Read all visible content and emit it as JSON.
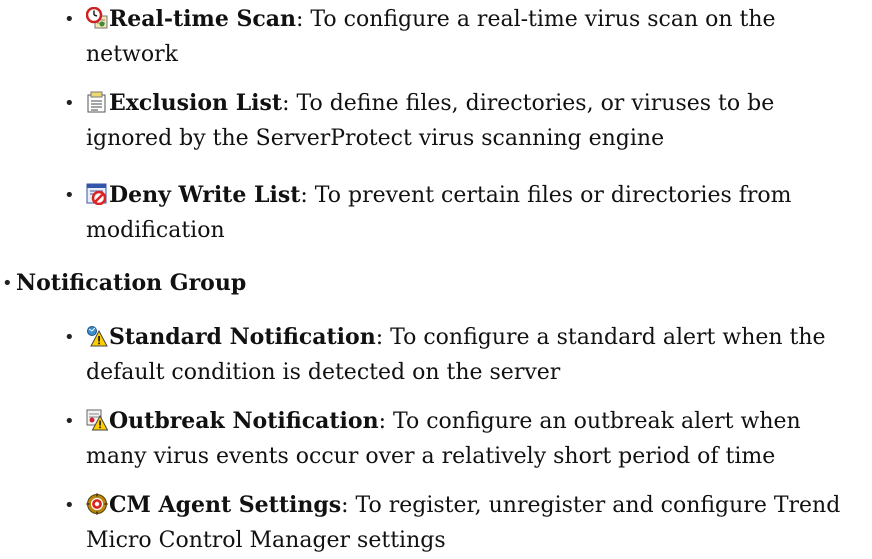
{
  "items": [
    {
      "icon": "real-time-scan-icon",
      "term": "Real-time Scan",
      "desc": ": To configure a real-time virus scan on the network"
    },
    {
      "icon": "exclusion-list-icon",
      "term": "Exclusion List",
      "desc": ": To define files, directories, or viruses to be ignored by the ServerProtect virus scanning engine"
    },
    {
      "icon": "deny-write-list-icon",
      "term": "Deny Write List",
      "desc": ": To prevent certain files or directories from modification"
    }
  ],
  "group": {
    "title": "Notification Group",
    "items": [
      {
        "icon": "standard-notification-icon",
        "term": "Standard Notification",
        "desc": ": To configure a standard alert when the default condition is detected on the server"
      },
      {
        "icon": "outbreak-notification-icon",
        "term": "Outbreak Notification",
        "desc": ": To configure an outbreak alert when many virus events occur over a relatively short period of time"
      },
      {
        "icon": "cm-agent-settings-icon",
        "term": "CM Agent Settings",
        "desc": ": To register, unregister and configure Trend Micro Control Manager settings"
      }
    ]
  },
  "bullet": "•"
}
